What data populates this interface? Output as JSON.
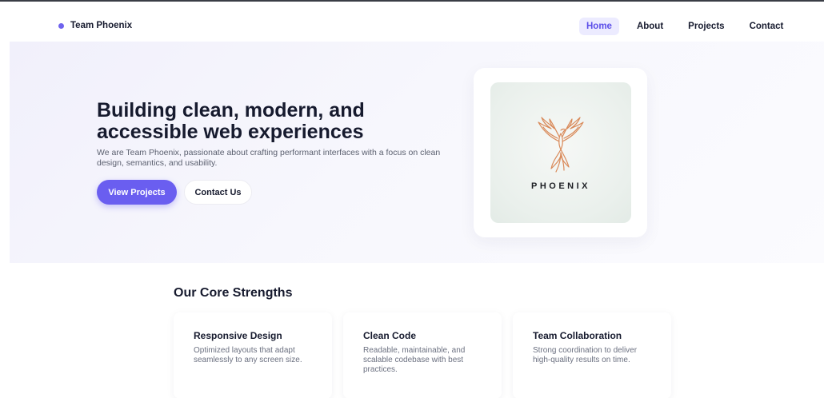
{
  "brand": {
    "name": "Team Phoenix",
    "dot_color": "#6f63ee"
  },
  "nav": {
    "links": [
      {
        "label": "Home",
        "active": true
      },
      {
        "label": "About",
        "active": false
      },
      {
        "label": "Projects",
        "active": false
      },
      {
        "label": "Contact",
        "active": false
      }
    ]
  },
  "hero": {
    "title": "Building clean, modern, and accessible web experiences",
    "subtitle": "We are Team Phoenix, passionate about crafting performant interfaces with a focus on clean design, semantics, and usability.",
    "primary_button": "View Projects",
    "secondary_button": "Contact Us",
    "logo_text": "PHOENIX",
    "logo_icon": "phoenix-bird-icon"
  },
  "strengths": {
    "title": "Our Core Strengths",
    "cards": [
      {
        "title": "Responsive Design",
        "text": "Optimized layouts that adapt seamlessly to any screen size."
      },
      {
        "title": "Clean Code",
        "text": "Readable, maintainable, and scalable codebase with best practices."
      },
      {
        "title": "Team Collaboration",
        "text": "Strong coordination to deliver high-quality results on time."
      }
    ]
  },
  "colors": {
    "accent": "#6a5ef0",
    "logo_stroke": "#d98a5a"
  }
}
